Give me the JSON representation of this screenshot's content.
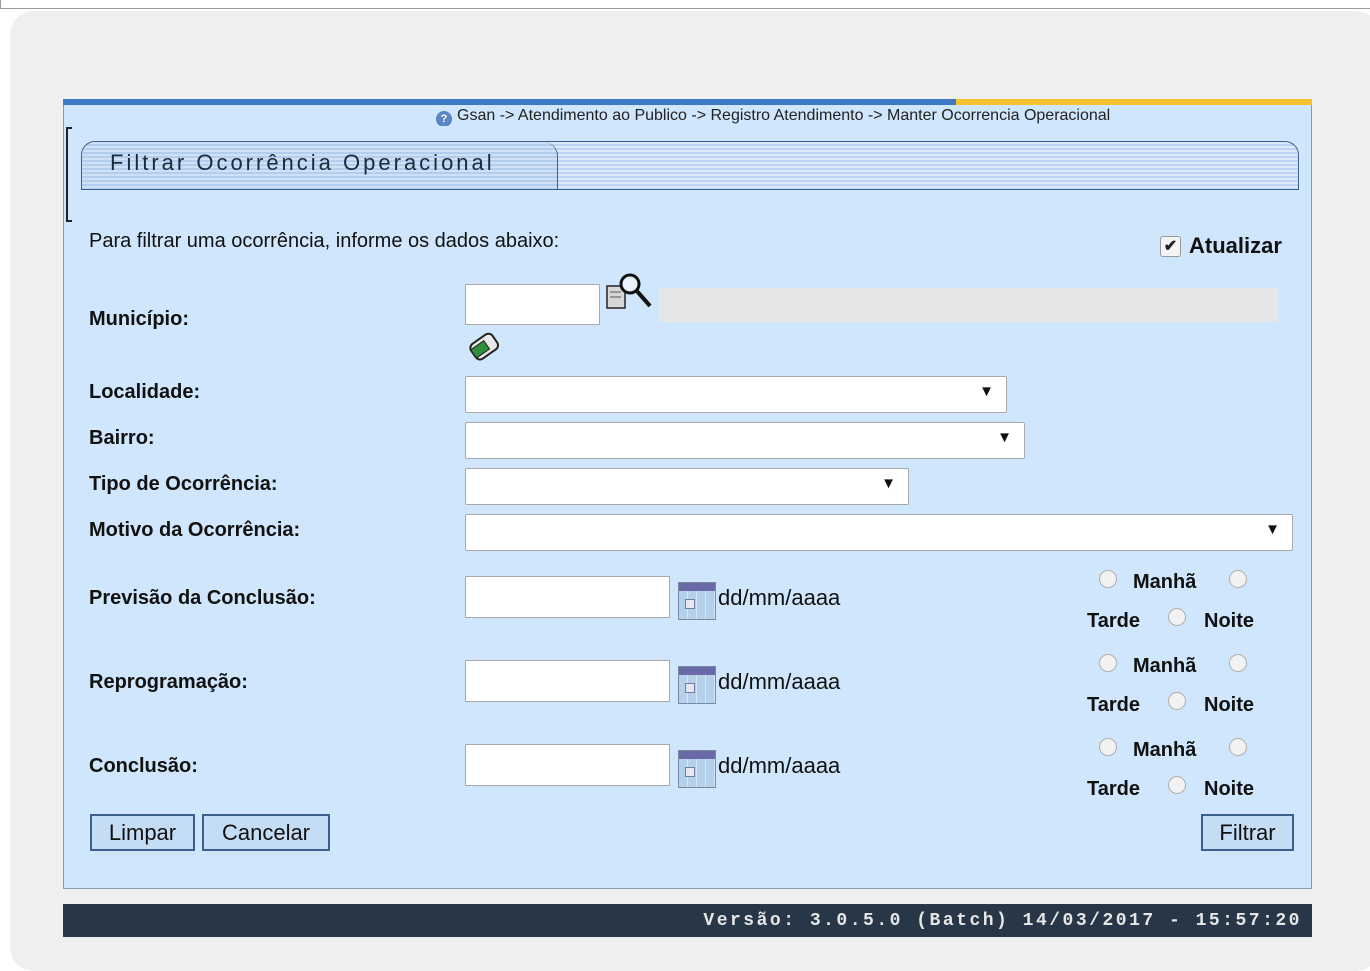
{
  "breadcrumb": "Gsan -> Atendimento ao Publico -> Registro Atendimento -> Manter Ocorrencia Operacional",
  "title": "Filtrar Ocorrência Operacional",
  "intro": "Para filtrar uma ocorrência, informe os dados abaixo:",
  "atualizar": {
    "label": "Atualizar",
    "checked": true
  },
  "fields": {
    "municipio": "Município:",
    "localidade": "Localidade:",
    "bairro": "Bairro:",
    "tipo": "Tipo de Ocorrência:",
    "motivo": "Motivo da Ocorrência:",
    "previsao": "Previsão da Conclusão:",
    "reprogramacao": "Reprogramação:",
    "conclusao": "Conclusão:"
  },
  "date_format": "dd/mm/aaaa",
  "periods": {
    "manha": "Manhã",
    "tarde": "Tarde",
    "noite": "Noite"
  },
  "buttons": {
    "limpar": "Limpar",
    "cancelar": "Cancelar",
    "filtrar": "Filtrar"
  },
  "version": "Versão: 3.0.5.0 (Batch) 14/03/2017 - 15:57:20",
  "colors": {
    "panel": "#cfe6fc",
    "accent_blue": "#3d78c4",
    "accent_yellow": "#f3c42d",
    "footer": "#283748"
  },
  "icons": [
    "help-icon",
    "search-icon",
    "eraser-icon",
    "calendar-icon",
    "dropdown-arrow-icon"
  ]
}
